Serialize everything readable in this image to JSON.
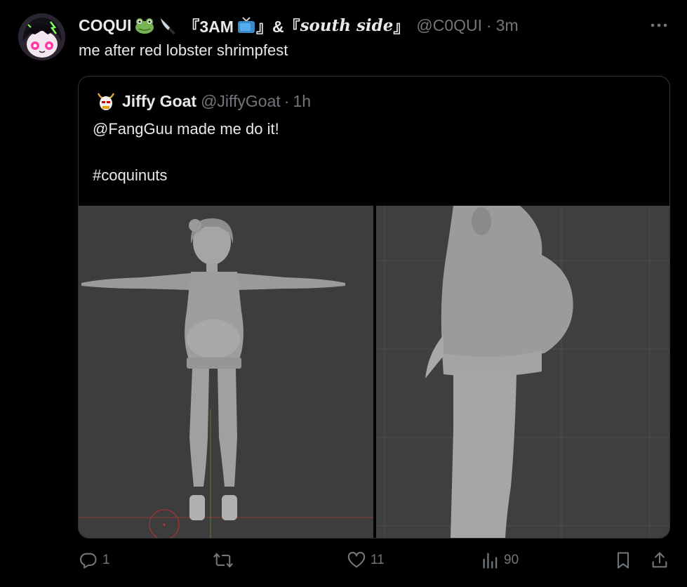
{
  "tweet": {
    "author_name": "COQUI",
    "name_suffix_1": "『3AM",
    "name_suffix_2": "』&『",
    "name_suffix_3": "south side",
    "name_suffix_4": "』",
    "handle": "@C0QUI",
    "time": "3m",
    "text": "me after red lobster shrimpfest"
  },
  "quote": {
    "author_name": "Jiffy Goat",
    "handle": "@JiffyGoat",
    "time": "1h",
    "line1": "@FangGuu made me do it!",
    "line2": "#coquinuts"
  },
  "actions": {
    "replies": "1",
    "reposts": "",
    "likes": "11",
    "views": "90"
  },
  "icons": {
    "more": "more-icon",
    "reply": "reply-icon",
    "repost": "repost-icon",
    "like": "like-icon",
    "views": "views-icon",
    "bookmark": "bookmark-icon",
    "share": "share-icon"
  },
  "colors": {
    "background": "#000000",
    "text": "#e7e9ea",
    "secondary": "#71767b",
    "border": "#2f3336"
  }
}
